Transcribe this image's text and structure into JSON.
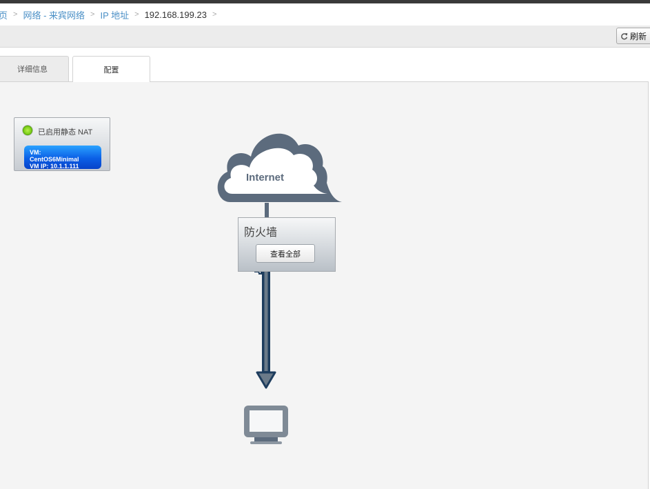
{
  "breadcrumb": {
    "items": [
      "页",
      "网络 - 来宾网络",
      "IP 地址",
      "192.168.199.23"
    ],
    "separator": ">"
  },
  "toolbar": {
    "refresh_label": "刷新",
    "refresh_icon": "refresh-icon"
  },
  "tabs": [
    {
      "label": "详细信息",
      "active": false
    },
    {
      "label": "配置",
      "active": true
    }
  ],
  "nat": {
    "status_label": "已启用静态 NAT",
    "status_color": "#7fd11b",
    "vm_line1": "VM:",
    "vm_line2": "CentOS6Minimal",
    "vm_line3": "VM IP: 10.1.1.111"
  },
  "diagram": {
    "internet_label": "Internet",
    "firewall_title": "防火墙",
    "view_all_label": "查看全部",
    "icons": [
      "cloud-icon",
      "arrow-down-icon",
      "monitor-icon"
    ],
    "accent_color": "#5c6b7d",
    "arrow_color": "#1e3d5e"
  }
}
